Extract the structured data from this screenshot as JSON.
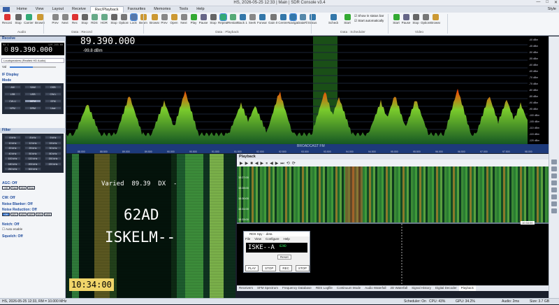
{
  "window": {
    "title": "HS, 2026-05-25 12:33 | Main | SDR Console v3.4",
    "controls": [
      "—",
      "□",
      "✕"
    ]
  },
  "menu": {
    "tabs": [
      "Home",
      "View",
      "Layout",
      "Receive",
      "Rec/Playback",
      "Favourites",
      "Memories",
      "Tools",
      "Help"
    ],
    "active": 4,
    "style_label": "Style"
  },
  "ribbon": {
    "buttons": [
      "Record",
      "Stop",
      "Carrier",
      "Browse",
      "Prev",
      "Next",
      "Rec",
      "Stop",
      "RDS",
      "HDR",
      "Stop",
      "Options",
      "Lock",
      "Beam",
      "Browse",
      "Prev",
      "Open",
      "Next",
      "Play",
      "Pause",
      "Stop",
      "Repeat",
      "Restart",
      "Back 10 seconds",
      "Seek",
      "Forward 10 seconds",
      "Gain 0 dB",
      "Centre",
      "Navigator",
      "DataFile Editor",
      "Status",
      "Schedule",
      "Start",
      "Start",
      "Pause",
      "Stop",
      "Options",
      "Browse"
    ],
    "groups": [
      "Audio",
      "Data : Record",
      "Data : Playback",
      "Data : Scheduler",
      "Video"
    ],
    "scheduler_opts": [
      "Show in status bar",
      "Start automatically"
    ]
  },
  "left": {
    "header": "Receive",
    "freq": "89.390.000",
    "freq_prefix": "0",
    "freq_small": "129.265.60",
    "freq_sub": "RX 1",
    "audio_device": "Loudspeakers (Realtek HD Audio)",
    "vol_label": "Vol",
    "if_display": "IF Display",
    "mode_label": "Mode",
    "mode_buttons": [
      "AM",
      "SAM",
      "DSB",
      "LSB",
      "USB",
      "CW-L",
      "CW-U",
      "WFM",
      "SFM",
      "NFM",
      "DRM",
      "User"
    ],
    "filter_label": "Filter",
    "filter_buttons": [
      "6 kHz",
      "8 kHz",
      "9 kHz",
      "10 kHz",
      "12 kHz",
      "15 kHz",
      "20 kHz",
      "25 kHz",
      "30 kHz",
      "40 kHz",
      "50 kHz",
      "80 kHz",
      "100 kHz",
      "120 kHz",
      "150 kHz",
      "180 kHz",
      "200 kHz",
      "220 kHz",
      "250 kHz",
      "300 kHz"
    ],
    "agc": "AGC: Off",
    "agc_buttons": [
      "Off",
      "Fast",
      "Med",
      "Slow"
    ],
    "cw": "CW: Off",
    "nb": "Noise Blanker: Off",
    "nr": "Noise Reduction: Off",
    "nr_buttons": [
      "Off",
      "NR1",
      "NR2",
      "NR3",
      "NR4",
      "NR5"
    ],
    "notch": "Notch: Off",
    "auto_enable": "Auto enable",
    "squelch": "Squelch: Off"
  },
  "spectrum": {
    "freq": "89.390.000",
    "level": "-99.8 dBm",
    "band_label": "BROADCAST FM",
    "db_ticks": [
      "-40 dBm",
      "-45 dBm",
      "-50 dBm",
      "-55 dBm",
      "-60 dBm",
      "-65 dBm",
      "-70 dBm",
      "-75 dBm",
      "-80 dBm",
      "-85 dBm",
      "-90 dBm",
      "-95 dBm",
      "-100 dBm",
      "-105 dBm",
      "-110 dBm",
      "-115 dBm",
      "-120 dBm"
    ],
    "freq_ticks": [
      "88.000",
      "88.500",
      "89.000",
      "89.500",
      "90.000",
      "90.500",
      "91.000",
      "91.500",
      "92.000",
      "92.500",
      "93.000",
      "93.500",
      "94.000",
      "94.500",
      "95.000",
      "95.500",
      "96.000",
      "96.500",
      "97.000",
      "97.500",
      "98.000"
    ]
  },
  "rds_display": {
    "line1": "Varied  89.39  DX  -",
    "ps": "62AD",
    "rt": "ISKELM--",
    "clock": "10:34:00"
  },
  "playback": {
    "header": "Playback",
    "times": [
      "10:27:00",
      "10:28:00",
      "10:30:00",
      "10:31:00",
      "10:33:00"
    ],
    "cursor_time": "10:34:00"
  },
  "rds_spy": {
    "title": "RDS Spy - .deta",
    "menu": [
      "File",
      "View",
      "Configure",
      "Help"
    ],
    "ps": "ISKE--A",
    "pi": "62AD",
    "buttons": [
      "PLAY",
      "STOP",
      "REC",
      "STOP"
    ],
    "reset": "Reset"
  },
  "tabs": {
    "items": [
      "Receivers",
      "SFM Spectrum",
      "Frequency Database",
      "RDS Logfile",
      "Continuum Mode",
      "Audio Waterfall",
      "2D Waterfall",
      "Signal History",
      "Digital Decoder",
      "Playback"
    ],
    "active": 9
  },
  "status": {
    "left": "HS, 2026-05-25 12:33, RM = 10.000 MHz",
    "scheduler": "Scheduler: On",
    "cpu": "CPU: 43%",
    "gpu": "GPU: 34.2%",
    "audio": "Audio: 2ms",
    "size": "Size: 3.7 GB"
  },
  "colors": {
    "spectrum_fill": "#3a9a25",
    "peak": "#ff4a00",
    "highlight": "#2f8f2a",
    "freq_text": "#ffffff"
  }
}
